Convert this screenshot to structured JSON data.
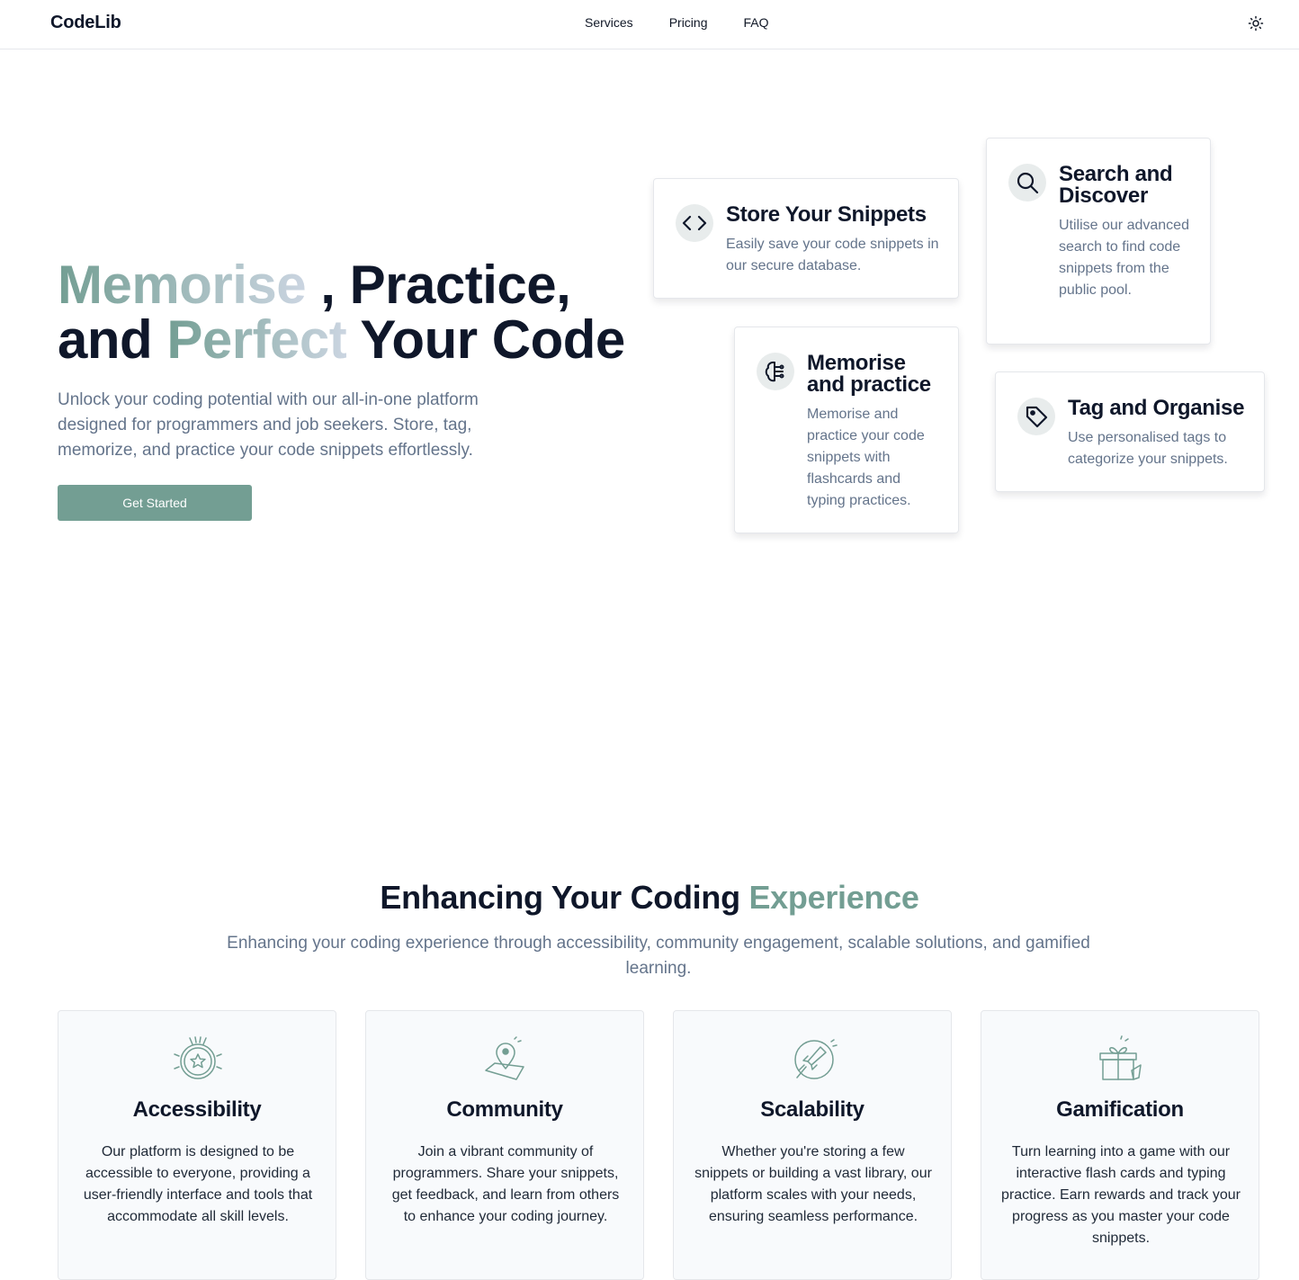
{
  "nav": {
    "logo": "CodeLib",
    "links": [
      "Services",
      "Pricing",
      "FAQ"
    ]
  },
  "hero": {
    "title_part1": "Memorise",
    "title_part2": " , Practice,",
    "title_part3": "and ",
    "title_part4": "Perfect",
    "title_part5": " Your Code",
    "description": "Unlock your coding potential with our all-in-one platform designed for programmers and job seekers. Store, tag, memorize, and practice your code snippets effortlessly.",
    "cta": "Get Started"
  },
  "features": [
    {
      "icon": "code-icon",
      "title": "Store Your Snippets",
      "description": "Easily save your code snippets in our secure database."
    },
    {
      "icon": "search-icon",
      "title": "Search and Discover",
      "description": "Utilise our advanced search to find code snippets from the public pool."
    },
    {
      "icon": "brain-icon",
      "title": "Memorise and practice",
      "description": "Memorise and practice your code snippets with flashcards and typing practices."
    },
    {
      "icon": "tag-icon",
      "title": "Tag and Organise",
      "description": "Use personalised tags to categorize your snippets."
    }
  ],
  "benefits": {
    "title": "Enhancing Your Coding ",
    "title_accent": "Experience",
    "description": "Enhancing your coding experience through accessibility, community engagement, scalable solutions, and gamified learning.",
    "items": [
      {
        "icon": "badge-star-icon",
        "title": "Accessibility",
        "description": "Our platform is designed to be accessible to everyone, providing a user-friendly interface and tools that accommodate all skill levels."
      },
      {
        "icon": "map-pin-icon",
        "title": "Community",
        "description": "Join a vibrant community of programmers. Share your snippets, get feedback, and learn from others to enhance your coding journey."
      },
      {
        "icon": "rocket-icon",
        "title": "Scalability",
        "description": "Whether you're storing a few snippets or building a vast library, our platform scales with your needs, ensuring seamless performance."
      },
      {
        "icon": "gift-icon",
        "title": "Gamification",
        "description": "Turn learning into a game with our interactive flash cards and typing practice. Earn rewards and track your progress as you master your code snippets."
      }
    ]
  },
  "colors": {
    "accent": "#739e93",
    "text": "#0f172a",
    "muted": "#64748b"
  }
}
